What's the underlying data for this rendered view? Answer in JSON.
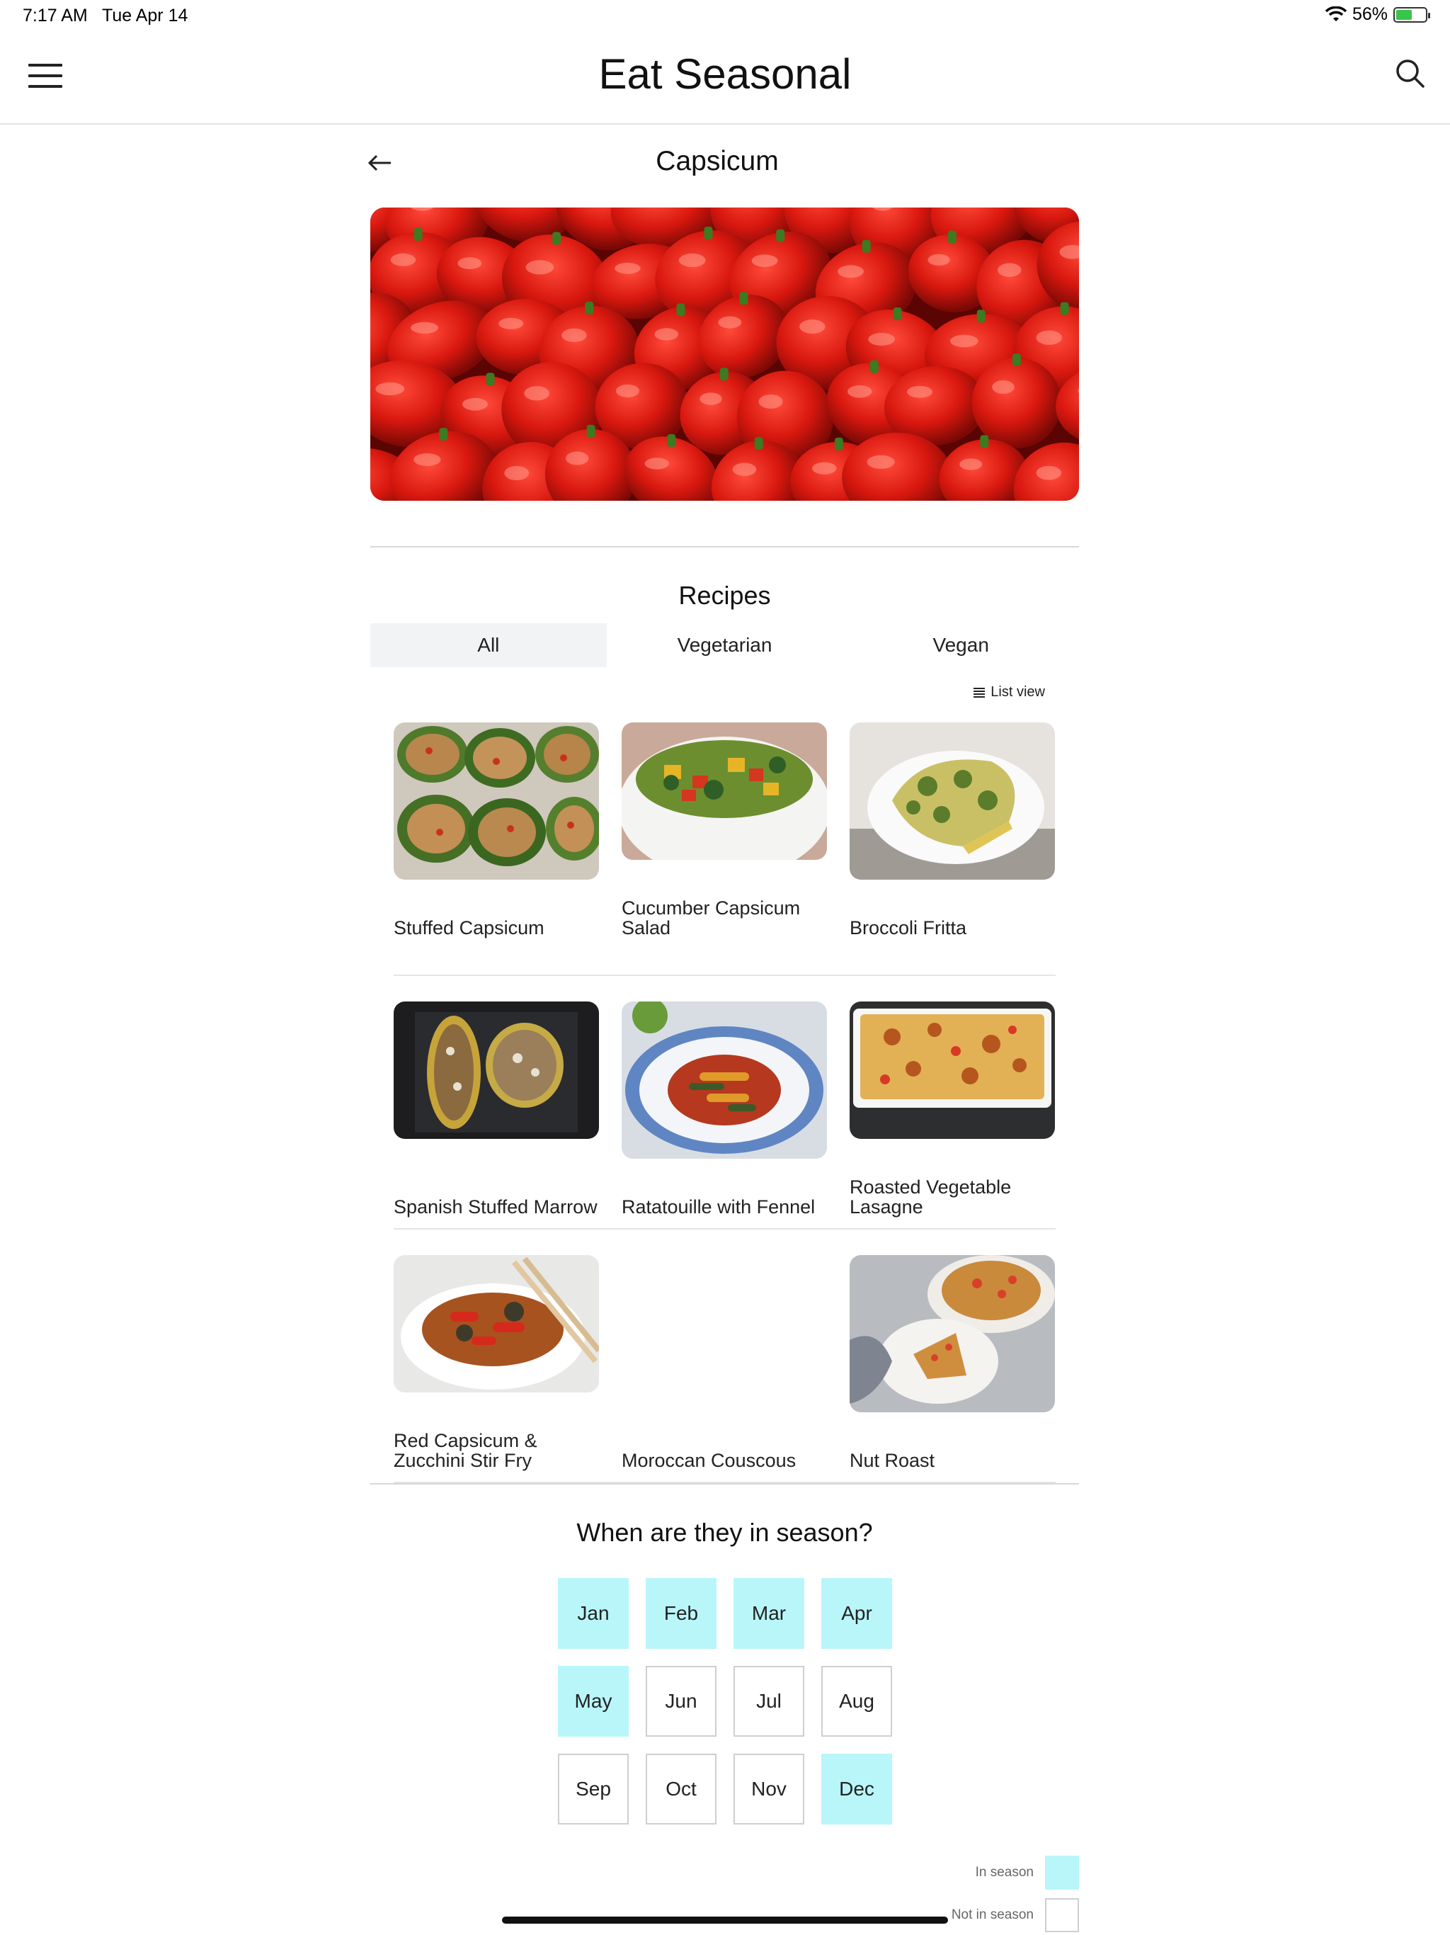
{
  "status_bar": {
    "time": "7:17 AM",
    "date": "Tue Apr 14",
    "battery": "56%",
    "battery_level": 0.56
  },
  "header": {
    "title": "Eat Seasonal",
    "menu_icon": "hamburger-menu-icon",
    "search_icon": "search-icon"
  },
  "page": {
    "title": "Capsicum",
    "back_icon": "back-arrow-icon",
    "hero_alt": "Red capsicums"
  },
  "recipes": {
    "heading": "Recipes",
    "tabs": [
      {
        "label": "All",
        "active": true
      },
      {
        "label": "Vegetarian",
        "active": false
      },
      {
        "label": "Vegan",
        "active": false
      }
    ],
    "list_view_label": "List view",
    "items": [
      {
        "name": "Stuffed Capsicum"
      },
      {
        "name": "Cucumber Capsicum Salad"
      },
      {
        "name": "Broccoli Fritta"
      },
      {
        "name": "Spanish Stuffed Marrow"
      },
      {
        "name": "Ratatouille with Fennel"
      },
      {
        "name": "Roasted Vegetable Lasagne"
      },
      {
        "name": "Red Capsicum & Zucchini Stir Fry"
      },
      {
        "name": "Moroccan Couscous"
      },
      {
        "name": "Nut Roast"
      }
    ]
  },
  "season": {
    "heading": "When are they in season?",
    "months": [
      {
        "label": "Jan",
        "in_season": true
      },
      {
        "label": "Feb",
        "in_season": true
      },
      {
        "label": "Mar",
        "in_season": true
      },
      {
        "label": "Apr",
        "in_season": true
      },
      {
        "label": "May",
        "in_season": true
      },
      {
        "label": "Jun",
        "in_season": false
      },
      {
        "label": "Jul",
        "in_season": false
      },
      {
        "label": "Aug",
        "in_season": false
      },
      {
        "label": "Sep",
        "in_season": false
      },
      {
        "label": "Oct",
        "in_season": false
      },
      {
        "label": "Nov",
        "in_season": false
      },
      {
        "label": "Dec",
        "in_season": true
      }
    ],
    "legend": {
      "in_label": "In season",
      "out_label": "Not in season"
    },
    "colors": {
      "in_season": "#b9f6fa",
      "not_in_season": "#ffffff"
    }
  }
}
